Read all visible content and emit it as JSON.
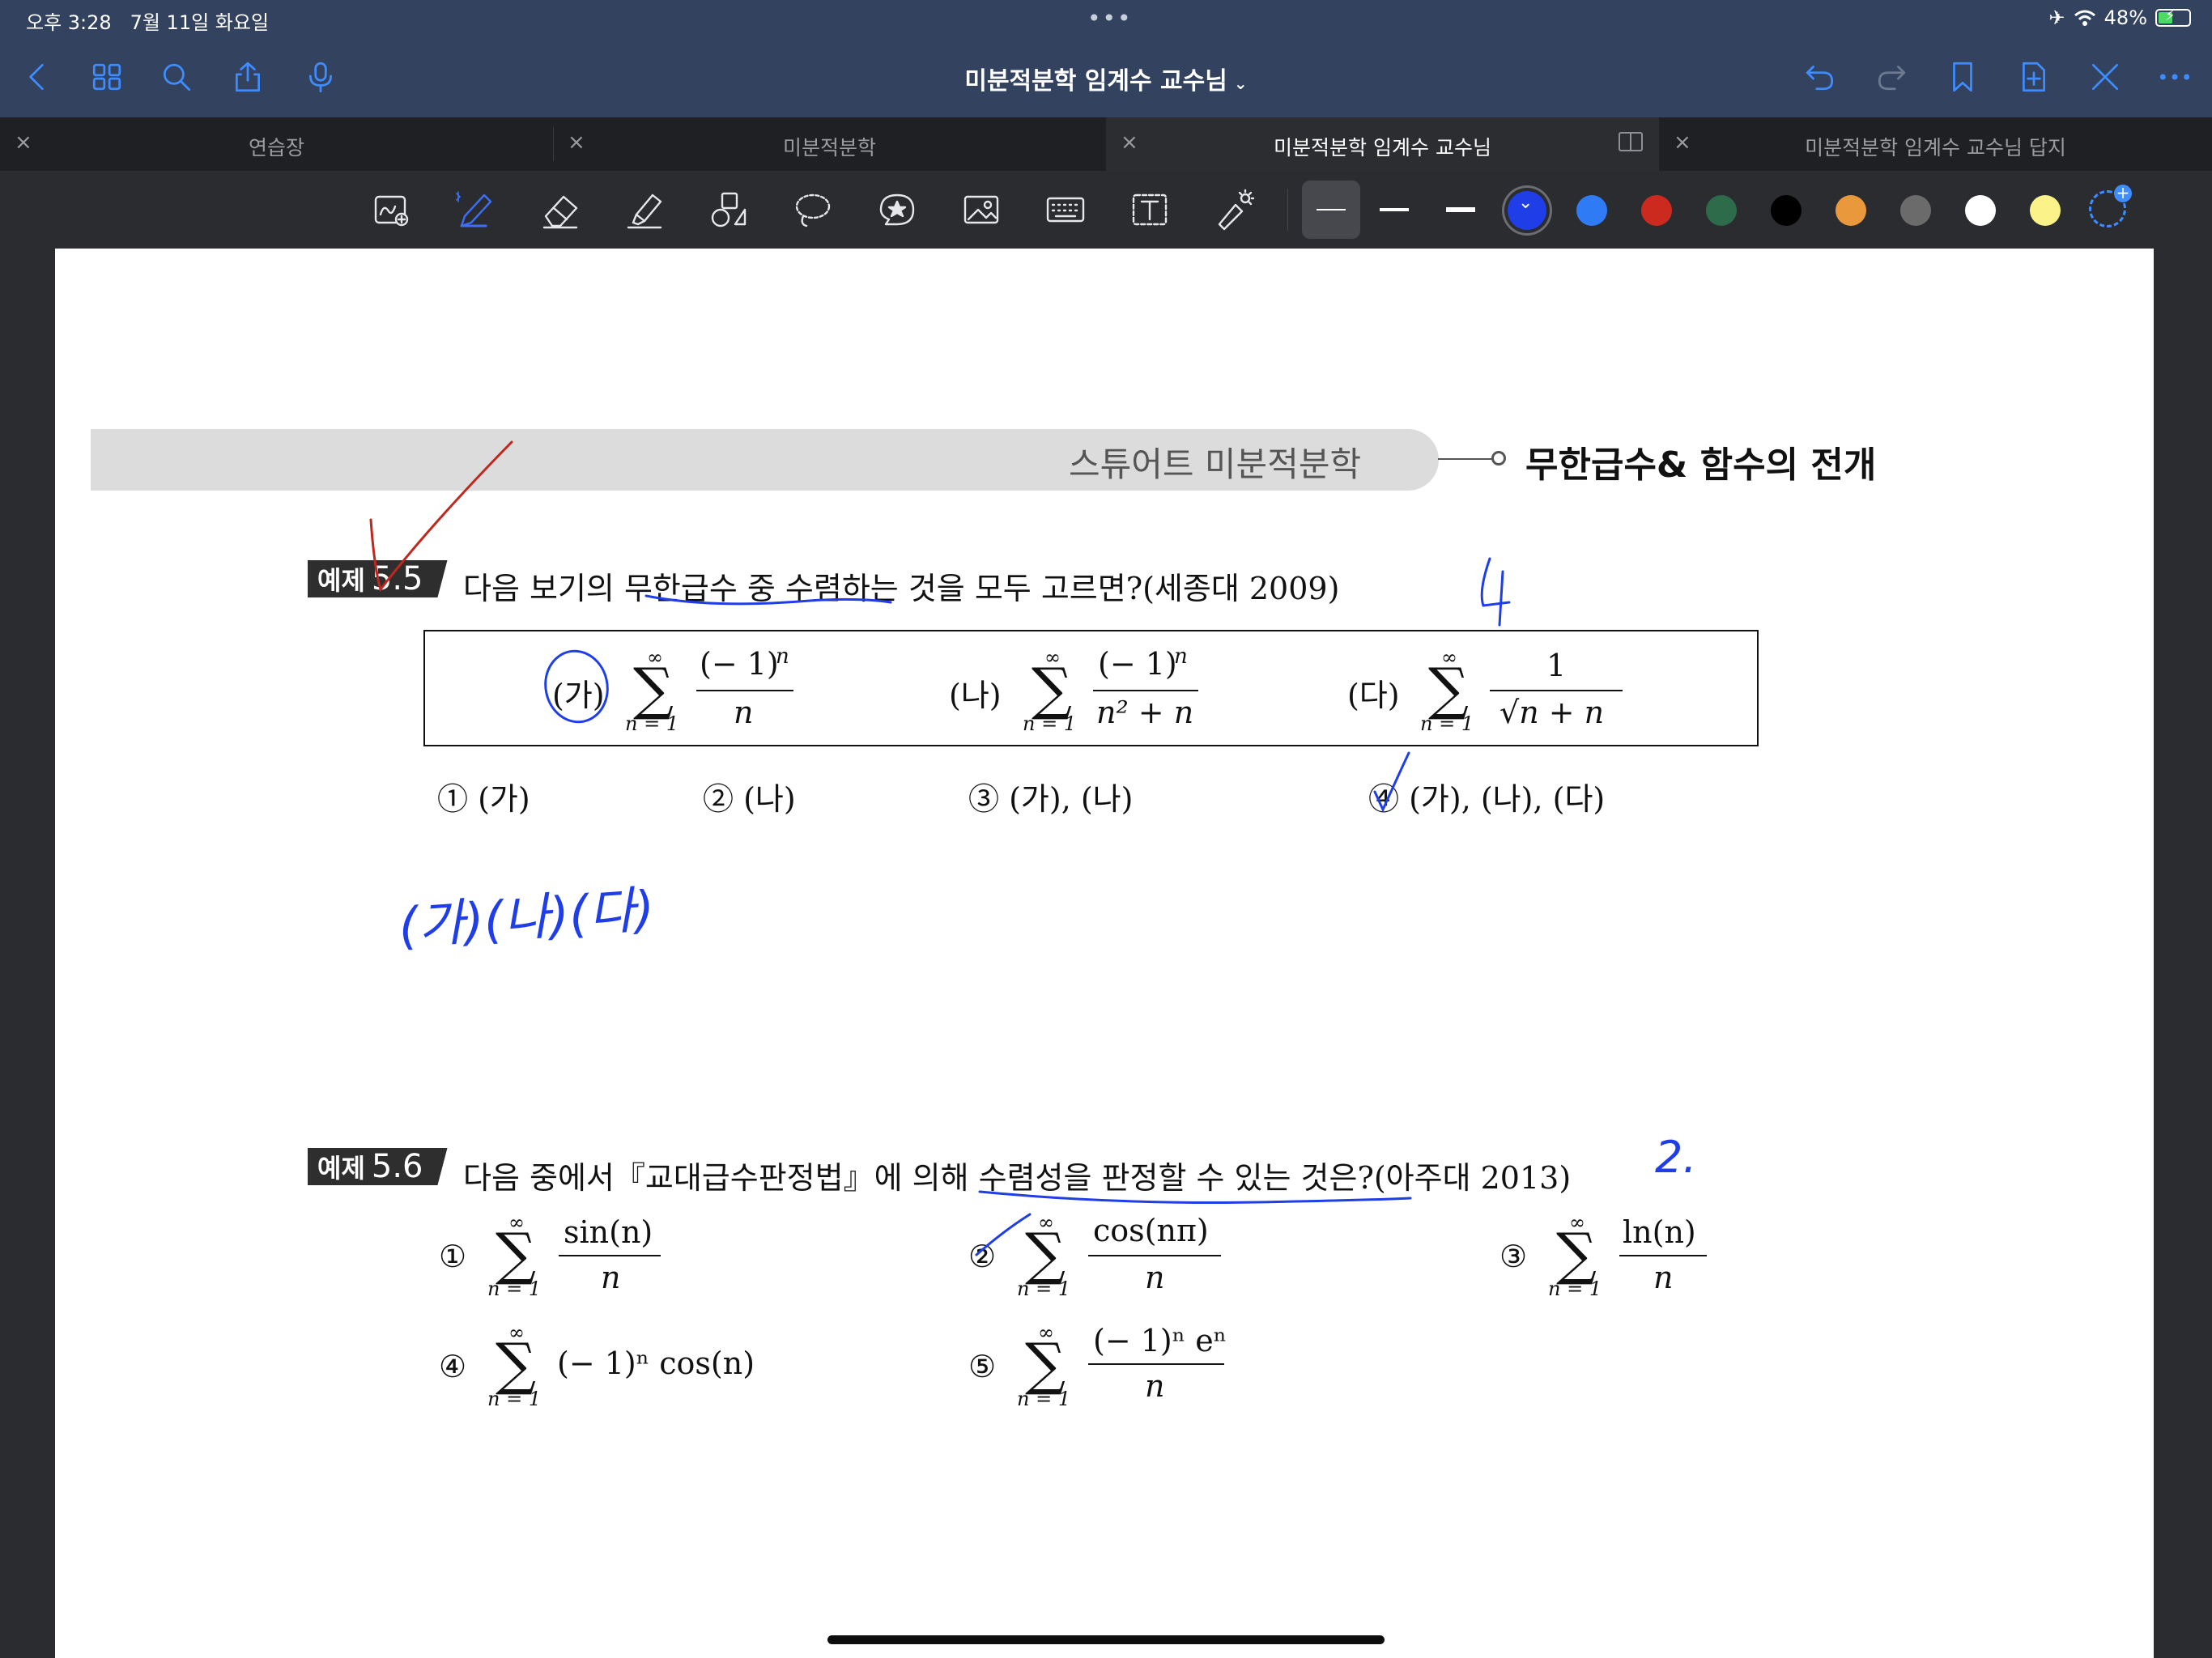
{
  "status": {
    "time": "오후 3:28",
    "date": "7월 11일 화요일",
    "battery": "48%",
    "battery_level": 0.48
  },
  "nav": {
    "title": "미분적분학 임계수 교수님"
  },
  "tabs": [
    {
      "label": "연습장",
      "active": false
    },
    {
      "label": "미분적분학",
      "active": false
    },
    {
      "label": "미분적분학 임계수 교수님",
      "active": true
    },
    {
      "label": "미분적분학 임계수 교수님 답지",
      "active": false
    }
  ],
  "toolbar": {
    "selected_tool": "pen",
    "colors": [
      "#1f3ee8",
      "#2f7bf5",
      "#cc2a1f",
      "#2e6b4b",
      "#000000",
      "#e9993c",
      "#6b6b6b",
      "#ffffff",
      "#fbf28a"
    ],
    "selected_color": "#1f3ee8"
  },
  "page": {
    "header_left": "스튜어트 미분적분학",
    "header_right": "무한급수& 함수의 전개",
    "ex1": {
      "badge": "예제",
      "num": "5.5",
      "question": "다음 보기의 무한급수 중 수렴하는 것을 모두 고르면?(세종대 2009)",
      "items": [
        {
          "label": "(가)",
          "num": "(− 1)",
          "exp": "n",
          "den": "n"
        },
        {
          "label": "(나)",
          "num": "(− 1)",
          "exp": "n",
          "den": "n² + n"
        },
        {
          "label": "(다)",
          "num": "1",
          "den": "√n + n"
        }
      ],
      "choices": [
        "① (가)",
        "② (나)",
        "③ (가), (나)",
        "④ (가), (나), (다)"
      ]
    },
    "ex2": {
      "badge": "예제",
      "num": "5.6",
      "question": "다음 중에서『교대급수판정법』에 의해 수렴성을 판정할 수 있는 것은?(아주대 2013)",
      "choices": [
        {
          "mark": "①",
          "num": "sin(n)",
          "den": "n"
        },
        {
          "mark": "②",
          "num": "cos(nπ)",
          "den": "n"
        },
        {
          "mark": "③",
          "num": "ln(n)",
          "den": "n"
        },
        {
          "mark": "④",
          "expr": "(− 1)ⁿ cos(n)"
        },
        {
          "mark": "⑤",
          "num": "(− 1)ⁿ eⁿ",
          "den": "n"
        }
      ]
    },
    "sigma": {
      "top": "∞",
      "bottom": "n = 1",
      "symbol": "∑"
    },
    "handwriting": {
      "ex1_answer": "4",
      "ex1_note": "(가)(나)(다)",
      "ex2_answer": "2."
    }
  }
}
